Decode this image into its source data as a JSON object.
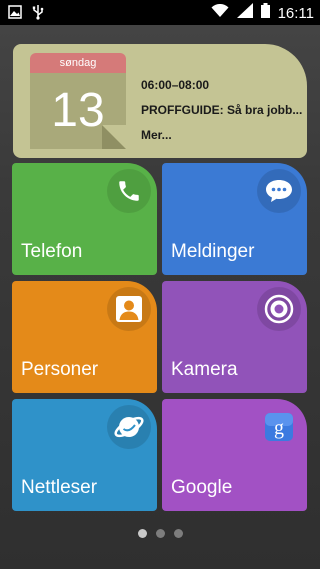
{
  "status_bar": {
    "time": "16:11",
    "icons": [
      "image-icon",
      "usb-icon",
      "wifi-icon",
      "signal-icon",
      "battery-icon"
    ]
  },
  "calendar_widget": {
    "day_name": "søndag",
    "day_number": "13",
    "event_time": "06:00–08:00",
    "event_title": "PROFFGUIDE: Så bra jobb...",
    "more": "Mer..."
  },
  "tiles": [
    {
      "label": "Telefon",
      "icon": "phone-icon",
      "color": "#58b148"
    },
    {
      "label": "Meldinger",
      "icon": "message-icon",
      "color": "#3b7ad4"
    },
    {
      "label": "Personer",
      "icon": "person-icon",
      "color": "#e48a19"
    },
    {
      "label": "Kamera",
      "icon": "camera-icon",
      "color": "#9153b9"
    },
    {
      "label": "Nettleser",
      "icon": "browser-icon",
      "color": "#2f92c9"
    },
    {
      "label": "Google",
      "icon": "google-icon",
      "color": "#a251c4"
    }
  ],
  "pager": {
    "pages": 3,
    "active": 1
  }
}
